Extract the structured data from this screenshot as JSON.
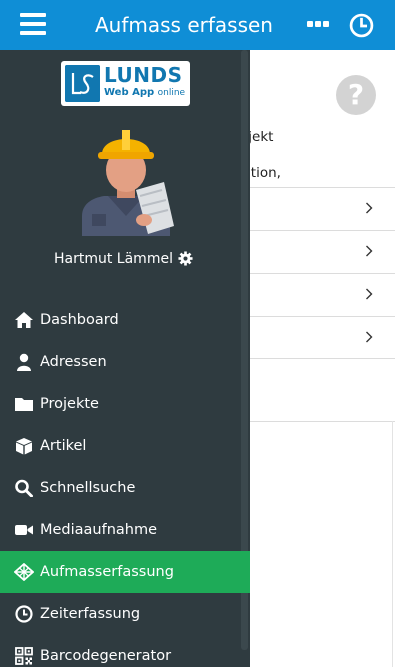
{
  "header": {
    "title": "Aufmass erfassen",
    "menu_icon": "hamburger-icon",
    "more_icon": "more-dots-icon",
    "clock_icon": "clock-icon",
    "color": "#0f8ed6"
  },
  "page": {
    "help_glyph": "?",
    "description_lines": [
      "ojekt",
      "sition,"
    ],
    "list_rows": 4
  },
  "drawer": {
    "logo": {
      "mark": "LS",
      "brand": "LUNDS",
      "sub": "Web App",
      "sub_suffix": "online"
    },
    "user": {
      "name": "Hartmut Lämmel",
      "settings_icon": "gear-icon"
    },
    "active_color": "#1eab58",
    "background": "#2f3b40",
    "items": [
      {
        "label": "Dashboard",
        "icon": "home-icon"
      },
      {
        "label": "Adressen",
        "icon": "user-icon"
      },
      {
        "label": "Projekte",
        "icon": "folder-icon"
      },
      {
        "label": "Artikel",
        "icon": "cube-icon"
      },
      {
        "label": "Schnellsuche",
        "icon": "search-icon"
      },
      {
        "label": "Mediaaufnahme",
        "icon": "video-camera-icon"
      },
      {
        "label": "Aufmasserfassung",
        "icon": "measure-icon",
        "active": true
      },
      {
        "label": "Zeiterfassung",
        "icon": "clock-icon"
      },
      {
        "label": "Barcodegenerator",
        "icon": "qrcode-icon"
      }
    ]
  }
}
